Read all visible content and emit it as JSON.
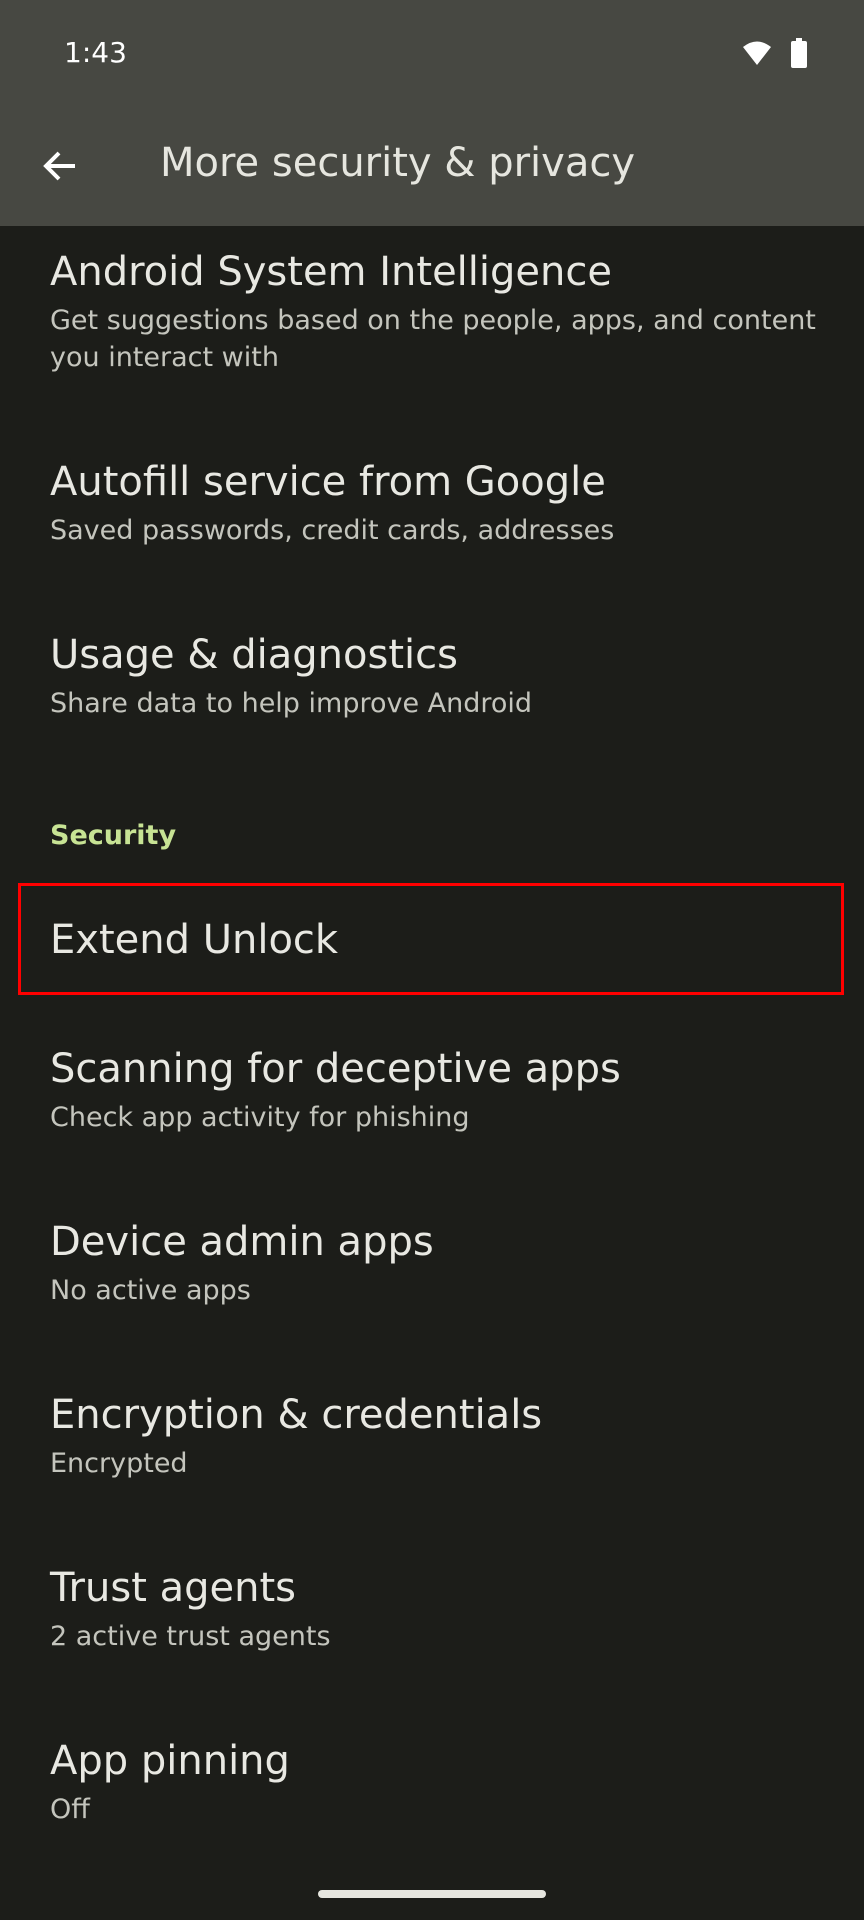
{
  "status_bar": {
    "time": "1:43",
    "icons": [
      "wifi-icon",
      "battery-icon"
    ]
  },
  "app_bar": {
    "title": "More security & privacy",
    "back_icon": "arrow-back-icon"
  },
  "items_top": [
    {
      "title": "Android System Intelligence",
      "subtitle": "Get suggestions based on the people, apps, and content you interact with"
    },
    {
      "title": "Autofill service from Google",
      "subtitle": "Saved passwords, credit cards, addresses"
    },
    {
      "title": "Usage & diagnostics",
      "subtitle": "Share data to help improve Android"
    }
  ],
  "security_section": {
    "header": "Security",
    "items": [
      {
        "title": "Extend Unlock",
        "highlighted": true
      },
      {
        "title": "Scanning for deceptive apps",
        "subtitle": "Check app activity for phishing"
      },
      {
        "title": "Device admin apps",
        "subtitle": "No active apps"
      },
      {
        "title": "Encryption & credentials",
        "subtitle": "Encrypted"
      },
      {
        "title": "Trust agents",
        "subtitle": "2 active trust agents"
      },
      {
        "title": "App pinning",
        "subtitle": "Off"
      }
    ]
  },
  "colors": {
    "background": "#1c1d19",
    "app_bar": "#474842",
    "section_header": "#c7e394",
    "highlight_border": "#ff0000"
  }
}
